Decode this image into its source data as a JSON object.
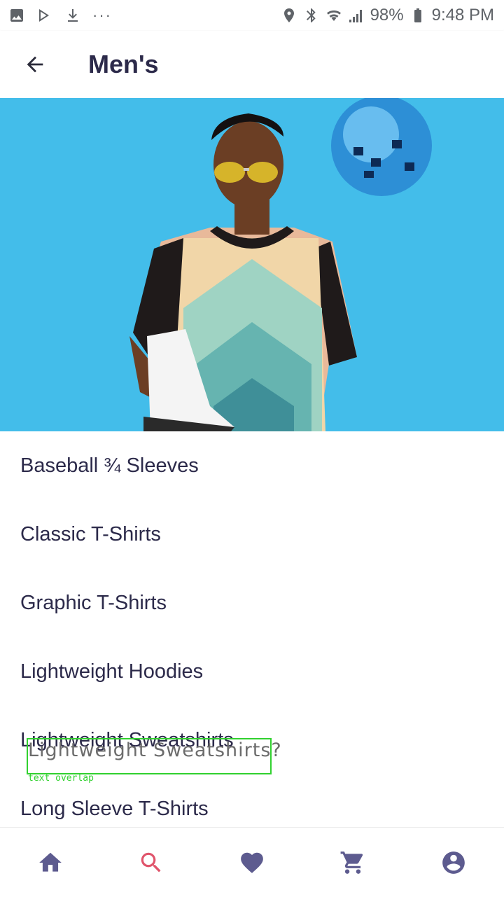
{
  "status_bar": {
    "left_icons": [
      "image-icon",
      "play-store-icon",
      "download-icon"
    ],
    "more": "···",
    "battery": "98%",
    "time": "9:48 PM"
  },
  "app_bar": {
    "title": "Men's"
  },
  "categories": [
    {
      "label": "Baseball ¾ Sleeves"
    },
    {
      "label": "Classic T-Shirts"
    },
    {
      "label": "Graphic T-Shirts"
    },
    {
      "label": "Lightweight Hoodies"
    },
    {
      "label": "Lightweight Sweatshirts"
    },
    {
      "label": "Long Sleeve T-Shirts"
    }
  ],
  "overlay": {
    "text": "Lightweight Sweatshirts?",
    "label": "text overlap",
    "color": "#31d12f"
  },
  "bottom_nav": {
    "items": [
      {
        "icon": "home-icon",
        "active": false
      },
      {
        "icon": "search-icon",
        "active": true
      },
      {
        "icon": "heart-icon",
        "active": false
      },
      {
        "icon": "cart-icon",
        "active": false
      },
      {
        "icon": "account-icon",
        "active": false
      }
    ]
  },
  "colors": {
    "accent": "#e0546b",
    "nav_icon": "#5d5b8f",
    "text": "#2c2a4a",
    "hero_background": "#35b6e6"
  }
}
